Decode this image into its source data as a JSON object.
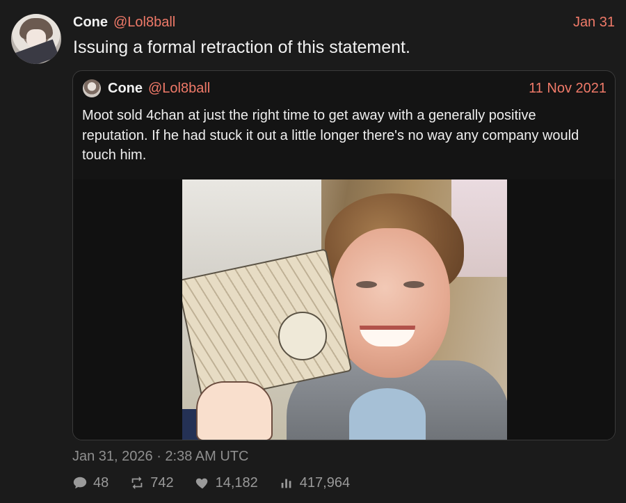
{
  "tweet": {
    "author_name": "Cone",
    "author_handle": "@Lol8ball",
    "date": "Jan 31",
    "text": "Issuing a formal retraction of this statement.",
    "timestamp": "Jan 31, 2026 · 2:38 AM UTC"
  },
  "quote": {
    "author_name": "Cone",
    "author_handle": "@Lol8ball",
    "date": "11 Nov 2021",
    "text": "Moot sold 4chan at just the right time to get away with a generally positive reputation. If he had stuck it out a little longer there's no way any company would touch him."
  },
  "stats": {
    "replies": "48",
    "retweets": "742",
    "likes": "14,182",
    "views": "417,964"
  },
  "icons": {
    "reply": "comment-bubble-icon",
    "retweet": "retweet-icon",
    "like": "heart-icon",
    "views": "bar-chart-icon"
  },
  "colors": {
    "accent": "#f07a69",
    "background": "#1b1b1b",
    "text": "#ececec",
    "muted": "#8f8f8f"
  }
}
